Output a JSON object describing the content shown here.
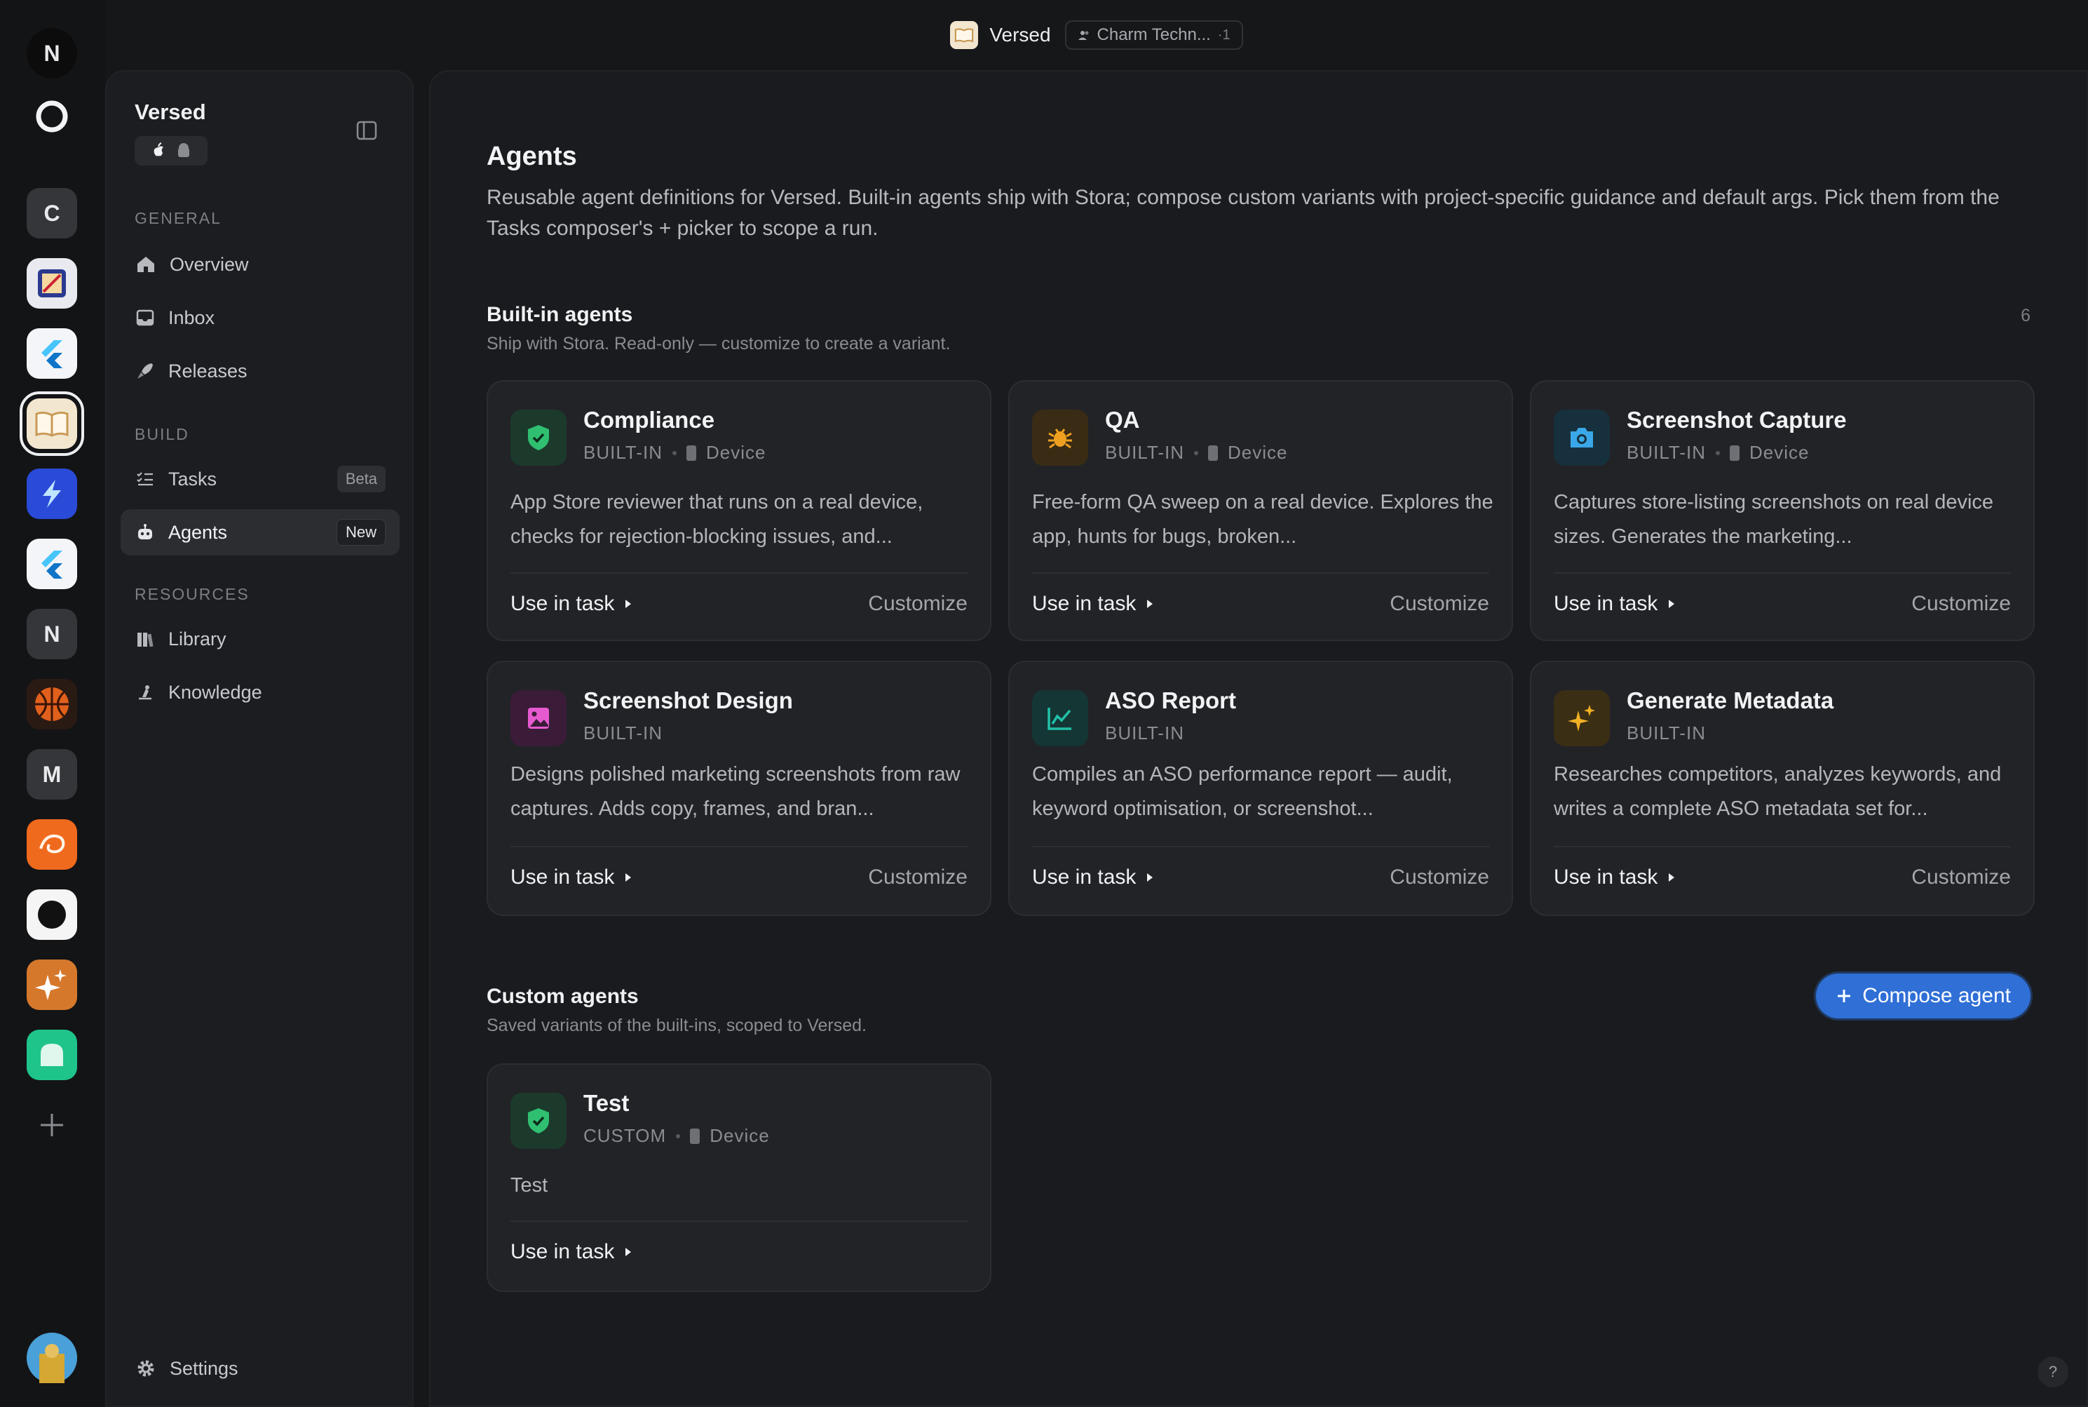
{
  "topbar": {
    "app_name": "Versed",
    "team_name": "Charm Techn...",
    "team_suffix": "·1"
  },
  "rail": {
    "items": [
      "N",
      "C",
      "N",
      "M"
    ]
  },
  "sidebar": {
    "project_name": "Versed",
    "sections": {
      "general": "GENERAL",
      "build": "BUILD",
      "resources": "RESOURCES"
    },
    "items": {
      "overview": "Overview",
      "inbox": "Inbox",
      "releases": "Releases",
      "tasks": "Tasks",
      "tasks_badge": "Beta",
      "agents": "Agents",
      "agents_badge": "New",
      "library": "Library",
      "knowledge": "Knowledge",
      "settings": "Settings"
    }
  },
  "main": {
    "title": "Agents",
    "description": "Reusable agent definitions for Versed. Built-in agents ship with Stora; compose custom variants with project-specific guidance and default args. Pick them from the Tasks composer's + picker to scope a run.",
    "builtin": {
      "title": "Built-in agents",
      "subtitle": "Ship with Stora. Read-only — customize to create a variant.",
      "count": "6",
      "cards": [
        {
          "name": "Compliance",
          "kind": "BUILT-IN",
          "target": "Device",
          "description": "App Store reviewer that runs on a real device, checks for rejection-blocking issues, and...",
          "use": "Use in task",
          "customize": "Customize",
          "icon": "shield-check-icon",
          "color": "#2fbf71"
        },
        {
          "name": "QA",
          "kind": "BUILT-IN",
          "target": "Device",
          "description": "Free-form QA sweep on a real device. Explores the app, hunts for bugs, broken...",
          "use": "Use in task",
          "customize": "Customize",
          "icon": "bug-icon",
          "color": "#f0a020"
        },
        {
          "name": "Screenshot Capture",
          "kind": "BUILT-IN",
          "target": "Device",
          "description": "Captures store-listing screenshots on real device sizes. Generates the marketing...",
          "use": "Use in task",
          "customize": "Customize",
          "icon": "camera-icon",
          "color": "#3aa8e8"
        },
        {
          "name": "Screenshot Design",
          "kind": "BUILT-IN",
          "target": "",
          "description": "Designs polished marketing screenshots from raw captures. Adds copy, frames, and bran...",
          "use": "Use in task",
          "customize": "Customize",
          "icon": "image-icon",
          "color": "#e65ad0"
        },
        {
          "name": "ASO Report",
          "kind": "BUILT-IN",
          "target": "",
          "description": "Compiles an ASO performance report — audit, keyword optimisation, or screenshot...",
          "use": "Use in task",
          "customize": "Customize",
          "icon": "chart-line-icon",
          "color": "#22c0a8"
        },
        {
          "name": "Generate Metadata",
          "kind": "BUILT-IN",
          "target": "",
          "description": "Researches competitors, analyzes keywords, and writes a complete ASO metadata set for...",
          "use": "Use in task",
          "customize": "Customize",
          "icon": "sparkles-icon",
          "color": "#f2b024"
        }
      ]
    },
    "custom": {
      "title": "Custom agents",
      "subtitle": "Saved variants of the built-ins, scoped to Versed.",
      "compose": "Compose agent",
      "cards": [
        {
          "name": "Test",
          "kind": "CUSTOM",
          "target": "Device",
          "description": "Test",
          "use": "Use in task",
          "icon": "shield-check-icon",
          "color": "#2fbf71"
        }
      ]
    },
    "help": "?"
  }
}
